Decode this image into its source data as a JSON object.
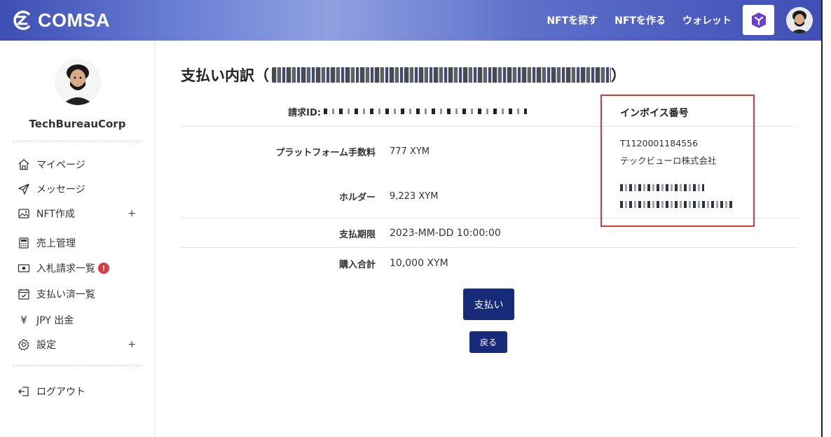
{
  "header": {
    "logo_text": "COMSA",
    "nav": [
      "NFTを探す",
      "NFTを作る",
      "ウォレット"
    ]
  },
  "sidebar": {
    "user_name": "TechBureauCorp",
    "items": [
      {
        "label": "マイページ",
        "icon": "home-icon"
      },
      {
        "label": "メッセージ",
        "icon": "send-icon"
      },
      {
        "label": "NFT作成",
        "icon": "image-icon",
        "expand": "+"
      },
      {
        "label": "売上管理",
        "icon": "calculator-icon"
      },
      {
        "label": "入札請求一覧",
        "icon": "cash-icon",
        "badge": "!"
      },
      {
        "label": "支払い済一覧",
        "icon": "calendar-check-icon"
      },
      {
        "label": "JPY 出金",
        "icon": "yen-icon"
      },
      {
        "label": "設定",
        "icon": "gear-icon",
        "expand": "+"
      }
    ],
    "logout_label": "ログアウト"
  },
  "main": {
    "title": "支払い内訳（",
    "title_close": "）",
    "request_id_label": "請求ID:",
    "rows": [
      {
        "label": "プラットフォーム手数料",
        "value": "777 XYM"
      },
      {
        "label": "ホルダー",
        "value": "9,223 XYM"
      },
      {
        "label": "支払期限",
        "value": "2023-MM-DD 10:00:00"
      },
      {
        "label": "購入合計",
        "value": "10,000 XYM"
      }
    ],
    "invoice": {
      "title": "インボイス番号",
      "number": "T1120001184556",
      "company": "テックビューロ株式会社"
    },
    "pay_button": "支払い",
    "back_button": "戻る"
  },
  "colors": {
    "primary_button": "#182a7a",
    "highlight_border": "#d63b3b",
    "badge": "#e0393e"
  }
}
